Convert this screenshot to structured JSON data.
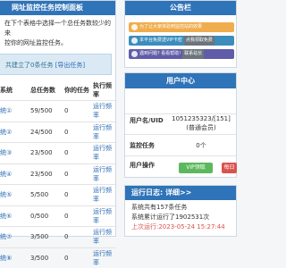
{
  "left_panel": {
    "title": "网址监控任务控制面板",
    "desc_line1": "在下个表格中选择一个总任务数较少的来",
    "desc_line2": "控你的网址监控任务。",
    "info_prefix": "共建立了0条任务 ",
    "info_link": "[导出任务]",
    "table": {
      "headers": [
        "系统",
        "总任务数",
        "你的任务",
        "执行频率"
      ],
      "rows": [
        {
          "type": "统①",
          "total": "59/500",
          "mine": "0",
          "freq": "运行频率"
        },
        {
          "type": "统②",
          "total": "24/500",
          "mine": "0",
          "freq": "运行频率"
        },
        {
          "type": "统③",
          "total": "23/500",
          "mine": "0",
          "freq": "运行频率"
        },
        {
          "type": "统④",
          "total": "23/500",
          "mine": "0",
          "freq": "运行频率"
        },
        {
          "type": "统⑤",
          "total": "5/500",
          "mine": "0",
          "freq": "运行频率"
        },
        {
          "type": "统⑥",
          "total": "0/500",
          "mine": "0",
          "freq": "运行频率"
        },
        {
          "type": "统⑦",
          "total": "3/500",
          "mine": "0",
          "freq": "运行频率"
        },
        {
          "type": "统⑧",
          "total": "3/500",
          "mine": "0",
          "freq": "运行频率"
        }
      ]
    }
  },
  "notice": {
    "title": "公告栏",
    "item1": "为了让大家体验到监控站的效果",
    "item2_text": "本平台免费送VIP卡密",
    "item2_tag": "点我领取免费",
    "item3_text": "遇到问题? 看看帮助!",
    "item3_tag": "联系站长"
  },
  "user_center": {
    "title": "用户中心",
    "name_label": "用户名/UID",
    "name_value": "1051235323/[151]",
    "name_sub": "(普通会员)",
    "tasks_label": "监控任务",
    "tasks_value": "0个",
    "ops_label": "用户操作",
    "vip_button": "VIP领取",
    "daily_button": "每日"
  },
  "run_log": {
    "title": "运行日志: 详细>>",
    "line1": "系统共有157条任务",
    "line2": "系统累计运行了1902531次",
    "line3": "上次运行:2023-05-24 15:27:44"
  },
  "colors": {
    "header_blue": "#2f73b8",
    "notice_orange": "#f0ad4e",
    "notice_blue": "#3c8dbc",
    "notice_purple": "#605ca8",
    "vip_green": "#5cb85c",
    "daily_red": "#d9534f"
  }
}
